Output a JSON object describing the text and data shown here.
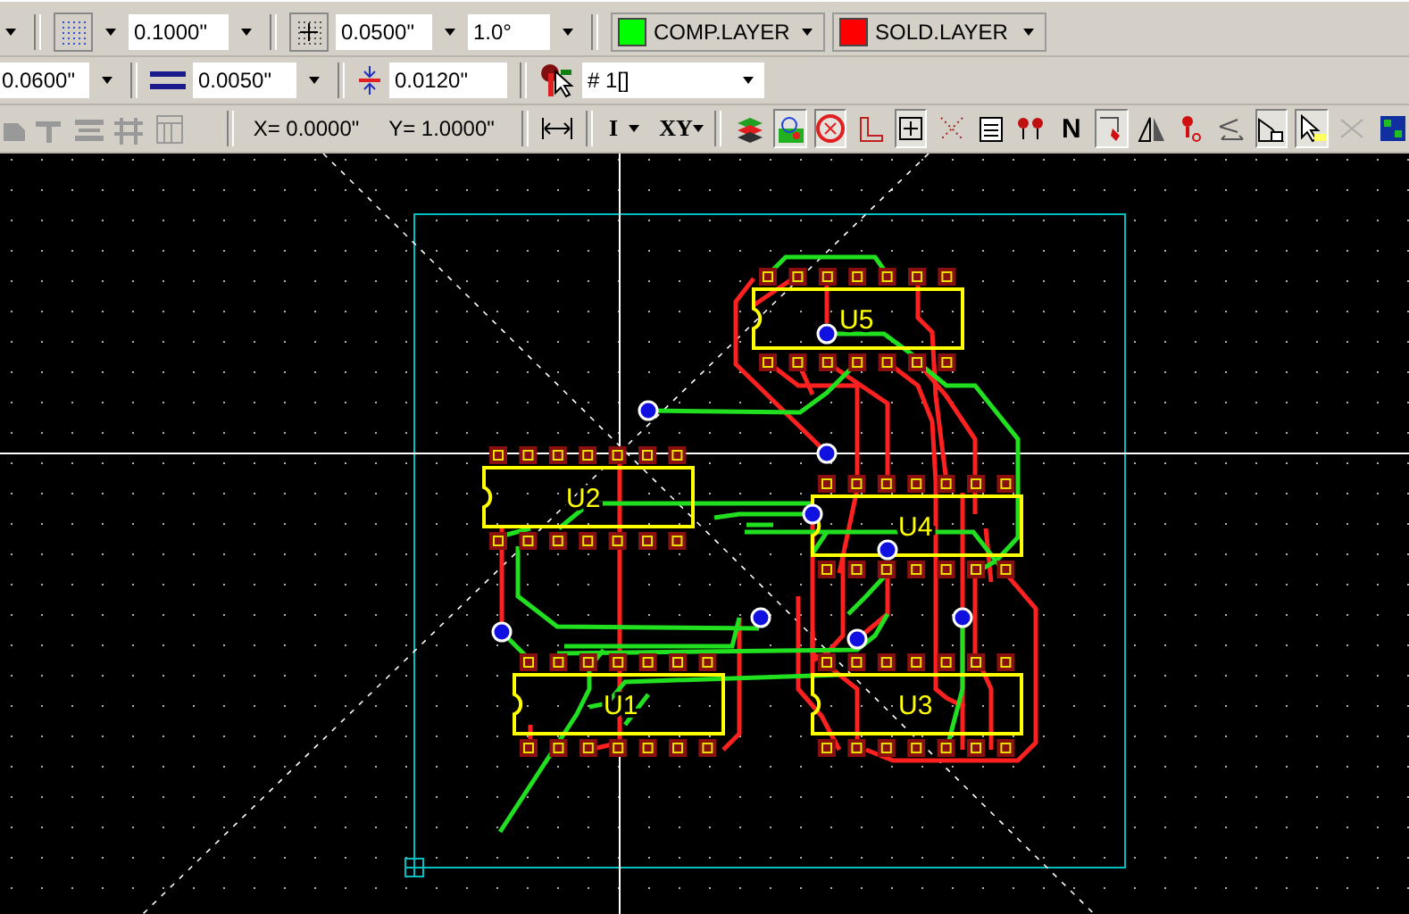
{
  "toolbar_1": {
    "grid": {
      "value": "0.1000\""
    },
    "snap": {
      "value": "0.0500\""
    },
    "angle": {
      "value": "1.0°"
    },
    "layers": [
      {
        "label": "COMP.LAYER",
        "color": "#00ff00"
      },
      {
        "label": "SOLD.LAYER",
        "color": "#ff0000"
      }
    ]
  },
  "toolbar_2": {
    "trace_width": {
      "value": "0.0600\""
    },
    "line_width": {
      "value": "0.0050\""
    },
    "clearance": {
      "value": "0.0120\""
    },
    "net": {
      "value": "# 1[]"
    }
  },
  "toolbar_3": {
    "x_coord": "X= 0.0000\"",
    "y_coord": "Y= 1.0000\"",
    "buttons": [
      {
        "label": "I"
      },
      {
        "label": "XY"
      }
    ],
    "tools": [
      {
        "kind": "layers",
        "pressed": false
      },
      {
        "kind": "target",
        "pressed": true
      },
      {
        "kind": "circle-x",
        "pressed": true
      },
      {
        "kind": "corner",
        "pressed": false
      },
      {
        "kind": "plus-square",
        "pressed": true
      },
      {
        "kind": "dotted-cross",
        "pressed": false
      },
      {
        "kind": "document",
        "pressed": false
      },
      {
        "kind": "pins",
        "pressed": false
      },
      {
        "kind": "letter",
        "label": "N",
        "pressed": false
      },
      {
        "kind": "pen-check",
        "pressed": true
      },
      {
        "kind": "triangles",
        "pressed": false
      },
      {
        "kind": "probe",
        "pressed": false
      },
      {
        "kind": "eye-arrows",
        "pressed": false
      },
      {
        "kind": "house-pointer",
        "pressed": true
      },
      {
        "kind": "cursor",
        "pressed": true
      },
      {
        "kind": "scissors",
        "pressed": false
      },
      {
        "kind": "board",
        "pressed": false
      }
    ]
  },
  "board": {
    "components": [
      {
        "label": "U5"
      },
      {
        "label": "U2"
      },
      {
        "label": "U4"
      },
      {
        "label": "U1"
      },
      {
        "label": "U3"
      }
    ]
  }
}
